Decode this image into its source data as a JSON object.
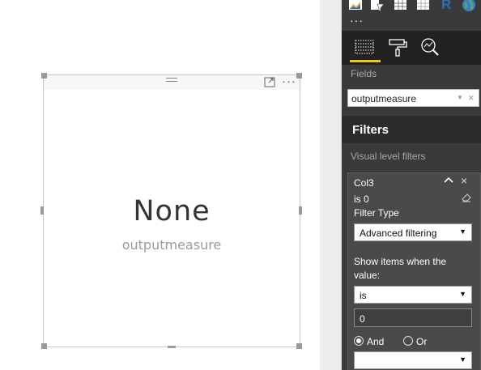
{
  "card": {
    "value": "None",
    "label": "outputmeasure"
  },
  "panel": {
    "more": "···",
    "visual_icons": [
      "area-chart-icon",
      "funnel-icon",
      "table-icon",
      "matrix-icon",
      "r-visual-icon",
      "globe-icon"
    ],
    "r_label": "R",
    "tabs": [
      "fields-tab",
      "format-tab",
      "analytics-tab"
    ],
    "fields_label": "Fields",
    "field_value": "outputmeasure",
    "filters_title": "Filters",
    "visual_level_label": "Visual level filters",
    "filter": {
      "title": "Col3",
      "description": "is 0",
      "filter_type_label": "Filter Type",
      "filter_type_value": "Advanced filtering",
      "show_items_label": "Show items when the value:",
      "condition_value": "is",
      "input_value": "0",
      "and_label": "And",
      "or_label": "Or",
      "second_condition_value": ""
    }
  },
  "colors": {
    "accent": "#f2c811",
    "panel_bg": "#3a3a3a",
    "filters_bg": "#2b2b2b"
  }
}
